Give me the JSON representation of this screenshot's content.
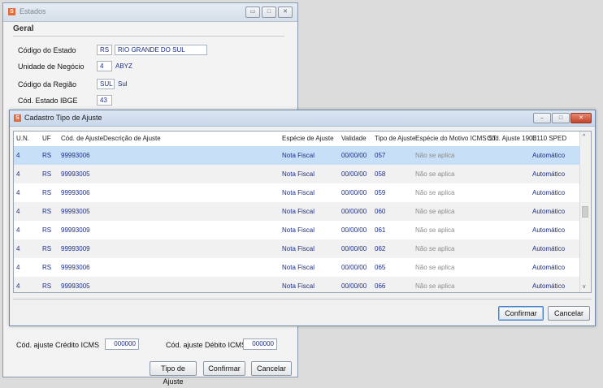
{
  "estados": {
    "title": "Estados",
    "group_title": "Geral",
    "fields": {
      "codigo_estado": {
        "label": "Código do Estado",
        "code": "RS",
        "name": "RIO GRANDE DO SUL"
      },
      "unidade_negocio": {
        "label": "Unidade de Negócio",
        "code": "4",
        "name": "ABYZ"
      },
      "codigo_regiao": {
        "label": "Código da Região",
        "code": "SUL",
        "name": "Sul"
      },
      "cod_estado_ibge": {
        "label": "Cód. Estado IBGE",
        "code": "43"
      }
    },
    "credito_label": "Cód. ajuste Crédito ICMS",
    "credito_value": "000000",
    "debito_label": "Cód. ajuste Débito ICMS",
    "debito_value": "000000",
    "buttons": {
      "tipo_ajuste": "Tipo de Ajuste",
      "confirmar": "Confirmar",
      "cancelar": "Cancelar"
    }
  },
  "cadastro": {
    "title": "Cadastro Tipo de Ajuste",
    "columns": [
      "U.N.",
      "UF",
      "Cód. de Ajuste",
      "Descrição de Ajuste",
      "Espécie de Ajuste",
      "Validade",
      "Tipo de Ajuste",
      "Espécie do Motivo ICMS ST",
      "Cód. Ajuste 1900",
      "E110 SPED"
    ],
    "rows": [
      {
        "un": "4",
        "uf": "RS",
        "cod": "99993006",
        "desc": "",
        "especie": "Nota Fiscal",
        "validade": "00/00/00",
        "tipo": "057",
        "motivo": "Não se aplica",
        "cod1900": "",
        "sped": "Automático"
      },
      {
        "un": "4",
        "uf": "RS",
        "cod": "99993005",
        "desc": "",
        "especie": "Nota Fiscal",
        "validade": "00/00/00",
        "tipo": "058",
        "motivo": "Não se aplica",
        "cod1900": "",
        "sped": "Automático"
      },
      {
        "un": "4",
        "uf": "RS",
        "cod": "99993006",
        "desc": "",
        "especie": "Nota Fiscal",
        "validade": "00/00/00",
        "tipo": "059",
        "motivo": "Não se aplica",
        "cod1900": "",
        "sped": "Automático"
      },
      {
        "un": "4",
        "uf": "RS",
        "cod": "99993005",
        "desc": "",
        "especie": "Nota Fiscal",
        "validade": "00/00/00",
        "tipo": "060",
        "motivo": "Não se aplica",
        "cod1900": "",
        "sped": "Automático"
      },
      {
        "un": "4",
        "uf": "RS",
        "cod": "99993009",
        "desc": "",
        "especie": "Nota Fiscal",
        "validade": "00/00/00",
        "tipo": "061",
        "motivo": "Não se aplica",
        "cod1900": "",
        "sped": "Automático"
      },
      {
        "un": "4",
        "uf": "RS",
        "cod": "99993009",
        "desc": "",
        "especie": "Nota Fiscal",
        "validade": "00/00/00",
        "tipo": "062",
        "motivo": "Não se aplica",
        "cod1900": "",
        "sped": "Automático"
      },
      {
        "un": "4",
        "uf": "RS",
        "cod": "99993006",
        "desc": "",
        "especie": "Nota Fiscal",
        "validade": "00/00/00",
        "tipo": "065",
        "motivo": "Não se aplica",
        "cod1900": "",
        "sped": "Automático"
      },
      {
        "un": "4",
        "uf": "RS",
        "cod": "99993005",
        "desc": "",
        "especie": "Nota Fiscal",
        "validade": "00/00/00",
        "tipo": "066",
        "motivo": "Não se aplica",
        "cod1900": "",
        "sped": "Automático"
      }
    ],
    "buttons": {
      "confirmar": "Confirmar",
      "cancelar": "Cancelar"
    }
  },
  "colors": {
    "selected_row": "#c7e0f7",
    "value_text": "#1c2d8a",
    "muted_text": "#8c8c8c"
  },
  "icons": [
    "app-icon",
    "minimize-icon",
    "maximize-icon",
    "close-icon",
    "scroll-up-icon",
    "scroll-down-icon"
  ]
}
